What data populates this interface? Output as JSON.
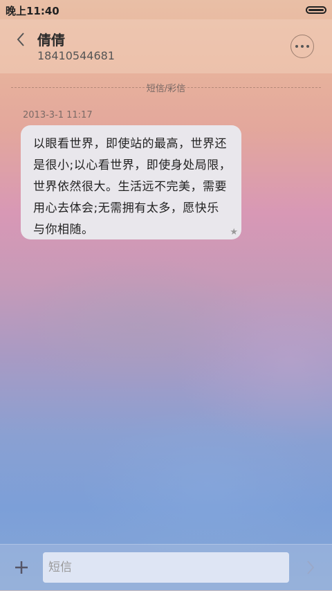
{
  "status_bar": {
    "time": "晚上11:40",
    "battery_icon": "battery-icon"
  },
  "header": {
    "back_icon": "chevron-left-icon",
    "contact_name": "倩倩",
    "contact_number": "18410544681",
    "more_icon": "more-dots-icon"
  },
  "thread": {
    "divider_label": "短信/彩信",
    "messages": [
      {
        "timestamp": "2013-3-1 11:17",
        "text": "以眼看世界，即使站的最高，世界还是很小;以心看世界，即使身处局限，世界依然很大。生活远不完美，需要用心去体会;无需拥有太多，愿快乐与你相随。",
        "lines": [
          "以眼看世界，即使站的最高，世界还",
          "是很小;以心看世界，即使身处局限，",
          "世界依然很大。生活远不完美，需要",
          "用心去体会;无需拥有太多，愿快乐",
          "与你相随。"
        ],
        "starred_icon": "star-icon"
      }
    ]
  },
  "composer": {
    "add_icon": "plus-icon",
    "placeholder": "短信",
    "send_icon": "chevron-right-icon"
  }
}
